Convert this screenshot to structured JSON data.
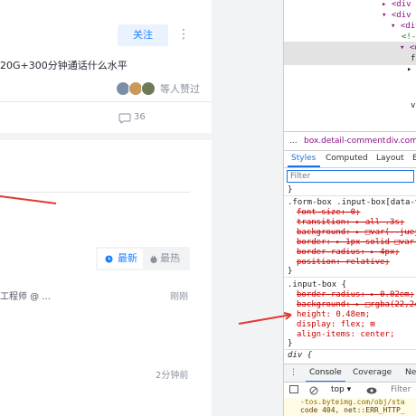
{
  "article": {
    "follow_label": "关注",
    "more_icon": "⋮",
    "title": "20G+300分钟通话什么水平",
    "liked_text": "等人赞过",
    "comment_count": "36"
  },
  "comments": {
    "tab_newest": "最新",
    "tab_hot": "最热",
    "entry1_author": "工程师 @ ...",
    "entry1_time": "刚刚",
    "entry2_time": "2分钟前"
  },
  "devtools": {
    "elements_lines": [
      "▸ <div c",
      "▾ <div c",
      "▾ <div",
      "<!--",
      "▾ <d",
      "f",
      "▸",
      "",
      "v",
      "",
      ""
    ],
    "breadcrumb": [
      "...",
      "box.detail-comment",
      "div.comm"
    ],
    "tabs": [
      "Styles",
      "Computed",
      "Layout",
      "E"
    ],
    "filter_placeholder": "Filter",
    "css": {
      "close1": "}",
      "rule1_selector": ".form-box .input-box[data-v",
      "rule1_p1": "font-size: 0;",
      "rule1_p2": "transition: ▸ all .3s;",
      "rule1_p3": "background: ▸ □var(--juej",
      "rule1_p4": "border: ▸ 1px solid □var(",
      "rule1_p5": "border-radius: ▸ 4px;",
      "rule1_p6": "position: relative;",
      "close2": "}",
      "rule2_selector": ".input-box {",
      "rule2_p1": "border-radius: ▸ 0.02em;",
      "rule2_p2": "background: ▸ □rgba(22,24",
      "rule2_p3": "height: 0.48em;",
      "rule2_p4": "display: flex; ⊞",
      "rule2_p5": "align-items: center;",
      "close3": "}",
      "rule3_selector": "div {"
    },
    "console_tabs": [
      "Console",
      "Coverage",
      "Ne"
    ],
    "console_context": "top ▾",
    "console_filter": "Filter",
    "console_lines": [
      "-tos.byteimg.com/obj/sta",
      "code 404, net::ERR_HTTP_"
    ]
  },
  "colors": {
    "accent": "#1e80ff",
    "annotation_red": "#e03a2f"
  }
}
